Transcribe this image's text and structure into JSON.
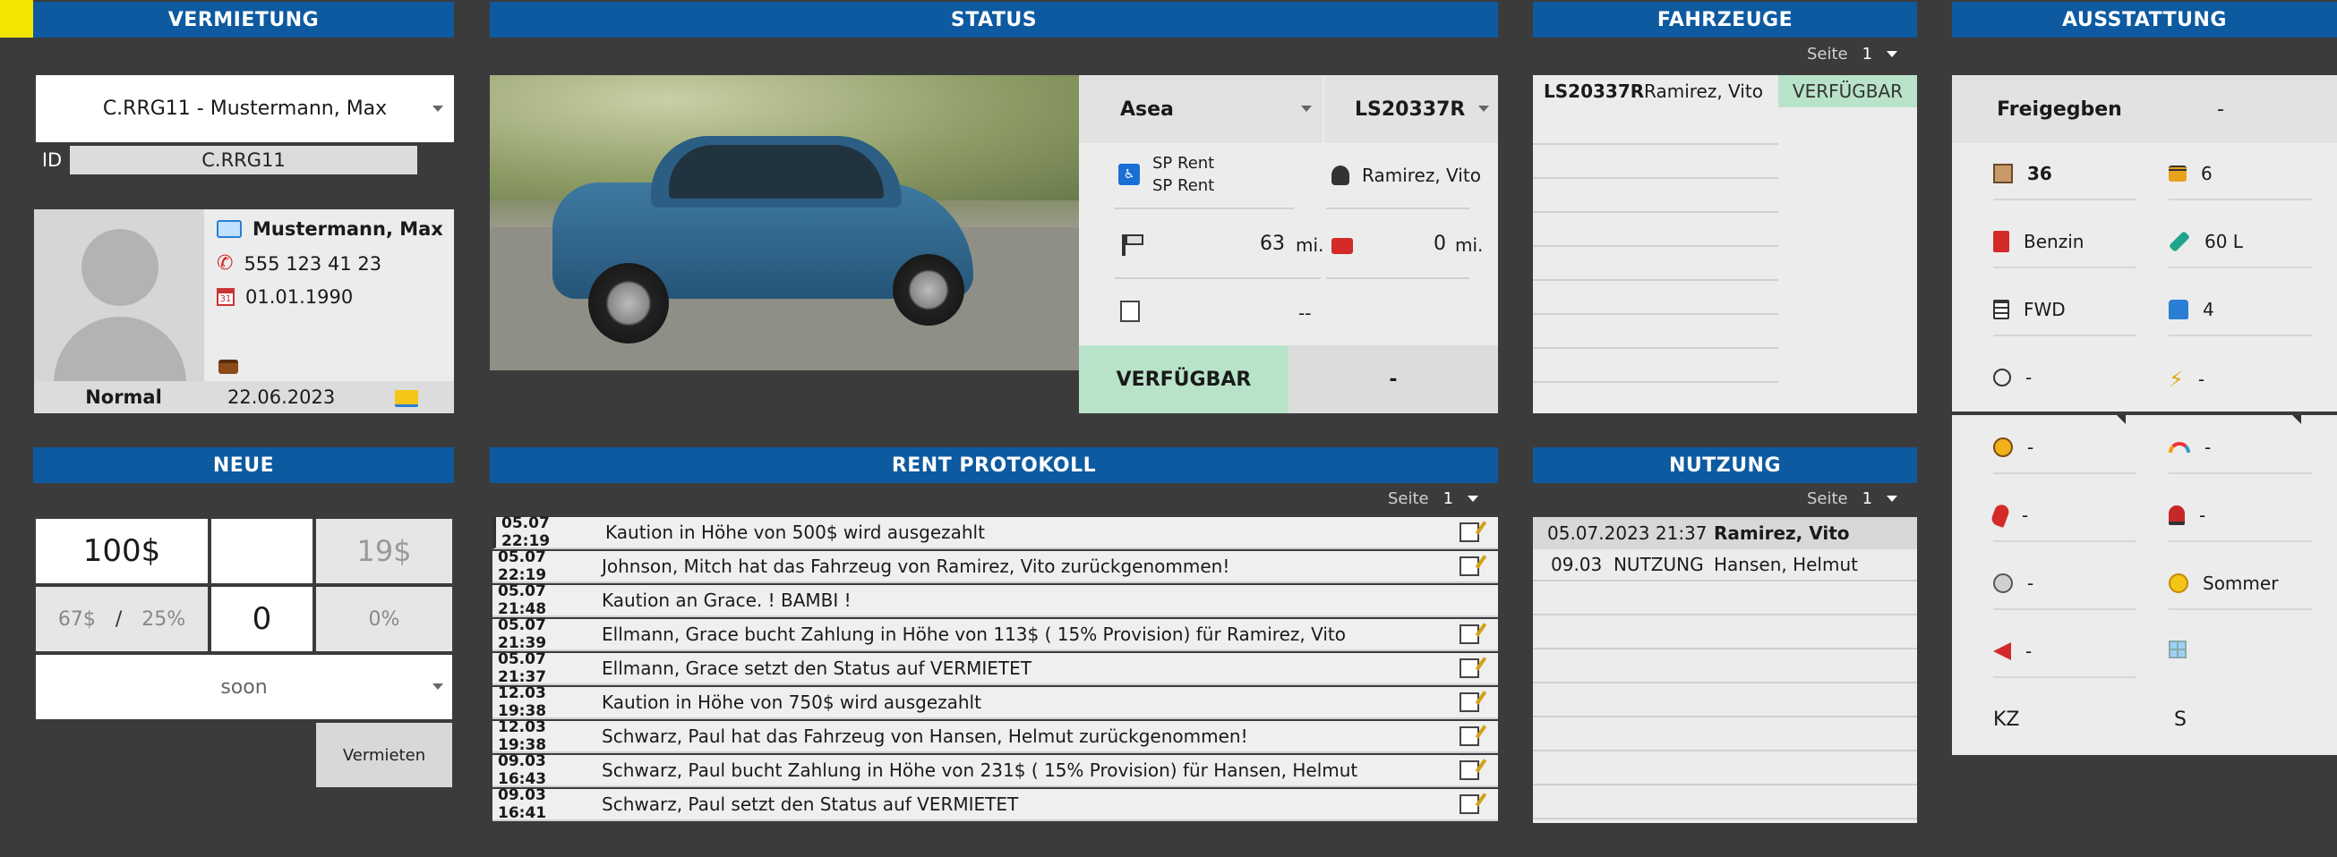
{
  "headers": {
    "vermietung": "VERMIETUNG",
    "status": "STATUS",
    "fahrzeuge": "FAHRZEUGE",
    "ausstattung": "AUSSTATTUNG",
    "neue": "NEUE",
    "rent_protokoll": "RENT PROTOKOLL",
    "nutzung": "NUTZUNG"
  },
  "vermietung": {
    "select_value": "C.RRG11 - Mustermann, Max",
    "id_label": "ID",
    "id_value": "C.RRG11",
    "name": "Mustermann, Max",
    "phone": "555 123 41 23",
    "birth": "01.01.1990",
    "level": "Normal",
    "date": "22.06.2023"
  },
  "status": {
    "model": "Asea",
    "plate": "LS20337R",
    "company_line1": "SP Rent",
    "company_line2": "SP Rent",
    "owner": "Ramirez, Vito",
    "mileage": "63",
    "mileage_unit": "mi.",
    "repair_mileage": "0",
    "repair_unit": "mi.",
    "note": "--",
    "state": "VERFÜGBAR",
    "state_extra": "-"
  },
  "fahrzeuge": {
    "seite_label": "Seite",
    "seite_num": "1",
    "rows": [
      {
        "plate": "LS20337R",
        "owner": "Ramirez, Vito",
        "status": "VERFÜGBAR"
      }
    ]
  },
  "ausstattung": {
    "freigegeben_label": "Freigegben",
    "freigegeben_value": "-",
    "items": [
      {
        "icon": "box-icon",
        "value": "36",
        "bold": true
      },
      {
        "icon": "lock-icon",
        "value": "6"
      },
      {
        "icon": "fuel-icon",
        "value": "Benzin"
      },
      {
        "icon": "fuel-nozzle-icon",
        "value": "60 L"
      },
      {
        "icon": "drivetrain-icon",
        "value": "FWD"
      },
      {
        "icon": "seat-icon",
        "value": "4"
      },
      {
        "icon": "gauge-icon",
        "value": "-"
      },
      {
        "icon": "lightning-icon",
        "value": "-"
      },
      {
        "icon": "palette-icon",
        "value": "-"
      },
      {
        "icon": "rainbow-icon",
        "value": "-"
      },
      {
        "icon": "parrot-icon",
        "value": "-"
      },
      {
        "icon": "siren-icon",
        "value": "-"
      },
      {
        "icon": "wheel-icon",
        "value": "-"
      },
      {
        "icon": "sun-icon",
        "value": "Sommer"
      },
      {
        "icon": "megaphone-icon",
        "value": "-"
      },
      {
        "icon": "window-icon",
        "value": ""
      }
    ],
    "kz_label": "KZ",
    "kz_value": "S"
  },
  "neue": {
    "price": "100$",
    "blank": "",
    "tax_placeholder": "19$",
    "sub_amount": "67$",
    "slash": "/",
    "sub_percent": "25%",
    "count": "0",
    "percent": "0%",
    "duration": "soon",
    "submit": "Vermieten"
  },
  "rent_protokoll": {
    "seite_label": "Seite",
    "seite_num": "1",
    "rows": [
      {
        "time": "05.07 22:19",
        "msg": "Kaution in Höhe von 500$ wird ausgezahlt",
        "note": true
      },
      {
        "time": "05.07 22:19",
        "msg": "Johnson, Mitch hat das Fahrzeug von Ramirez, Vito zurückgenommen!",
        "note": true
      },
      {
        "time": "05.07 21:48",
        "msg": "Kaution an Grace. ! BAMBI !",
        "note": false
      },
      {
        "time": "05.07 21:39",
        "msg": "Ellmann, Grace bucht Zahlung in Höhe von 113$ ( 15% Provision) für Ramirez, Vito",
        "note": true
      },
      {
        "time": "05.07 21:37",
        "msg": "Ellmann, Grace setzt den Status auf VERMIETET",
        "note": true
      },
      {
        "time": "12.03 19:38",
        "msg": "Kaution in Höhe von 750$ wird ausgezahlt",
        "note": true
      },
      {
        "time": "12.03 19:38",
        "msg": "Schwarz, Paul hat das Fahrzeug von Hansen, Helmut zurückgenommen!",
        "note": true
      },
      {
        "time": "09.03 16:43",
        "msg": "Schwarz, Paul bucht Zahlung in Höhe von 231$ ( 15% Provision) für Hansen, Helmut",
        "note": true
      },
      {
        "time": "09.03 16:41",
        "msg": "Schwarz, Paul setzt den Status auf VERMIETET",
        "note": true
      }
    ]
  },
  "nutzung": {
    "seite_label": "Seite",
    "seite_num": "1",
    "rows": [
      {
        "when": "05.07.2023 21:37",
        "who": "Ramirez, Vito"
      },
      {
        "when": "09.03  NUTZUNG",
        "who": "Hansen, Helmut"
      }
    ]
  },
  "colors": {
    "header_blue": "#0d5aa0",
    "background": "#3b3b3b",
    "available_green": "#b9e3c9",
    "corner_yellow": "#f2e600"
  }
}
